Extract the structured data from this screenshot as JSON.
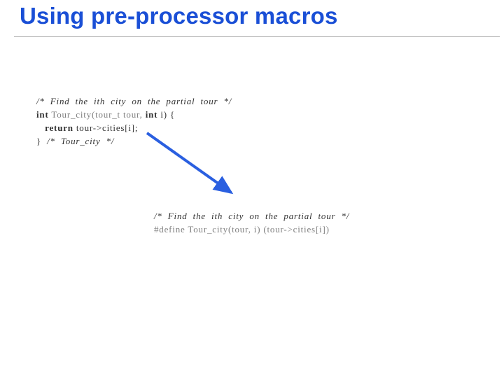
{
  "slide": {
    "title": "Using pre-processor macros",
    "code_block_a": {
      "line1_comment": "/*  Find  the  ith  city  on  the  partial  tour  */",
      "line2_kw1": "int",
      "line2_faded": " Tour_city(tour_t tour, ",
      "line2_kw2": "int",
      "line2_rest": " i) {",
      "line3_kw": "return",
      "line3_rest": " tour->cities[i];",
      "line4_close": "}  ",
      "line4_comment": "/*  Tour_city  */"
    },
    "code_block_b": {
      "line1_comment": "/*  Find  the  ith  city  on  the  partial  tour  */",
      "line2_faded": "#define Tour_city(tour, i) (tour->cities[i])"
    },
    "arrow": {
      "color": "#2a5fe0"
    }
  }
}
